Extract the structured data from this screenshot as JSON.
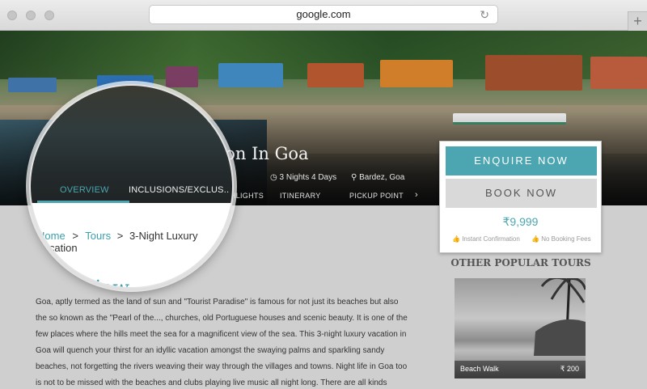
{
  "browser": {
    "url": "google.com",
    "new_tab_label": "+"
  },
  "hero": {
    "title": "3-Night Luxury Vacation In Goa",
    "duration": "3 Nights 4 Days",
    "location": "Bardez, Goa"
  },
  "tabs": [
    "OVERVIEW",
    "INCLUSIONS/EXCLUS..",
    "HIGHLIGHTS",
    "ITINERARY",
    "PICKUP POINT"
  ],
  "breadcrumb": {
    "home": "Home",
    "sep": ">",
    "tours": "Tours",
    "current": "3-Night Luxury Vacation"
  },
  "overview": {
    "heading": "Overview",
    "text": "Goa, aptly termed as the land of sun and \"Tourist Paradise\" is famous for not just its beaches but also the so known as the \"Pearl of the..., churches, old Portuguese houses and scenic beauty. It is one of the few places where the hills meet the sea for a magnificent view of the sea. This 3-night luxury vacation in Goa will quench your thirst for an idyllic vacation amongst the swaying palms and sparkling sandy beaches, not forgetting the rivers weaving their way through the villages and towns. Night life in Goa too is not to be missed with the beaches and clubs playing live music all night long. There are all kinds"
  },
  "booking": {
    "enquire_label": "ENQUIRE NOW",
    "book_label": "BOOK NOW",
    "price": "₹9,999",
    "feature_1": "Instant Confirmation",
    "feature_2": "No Booking Fees"
  },
  "popular": {
    "heading": "OTHER POPULAR TOURS",
    "tour_name": "Beach Walk",
    "tour_price": "₹ 200"
  },
  "colors": {
    "accent": "#4ba6b1",
    "heading": "#3aa0ad"
  }
}
